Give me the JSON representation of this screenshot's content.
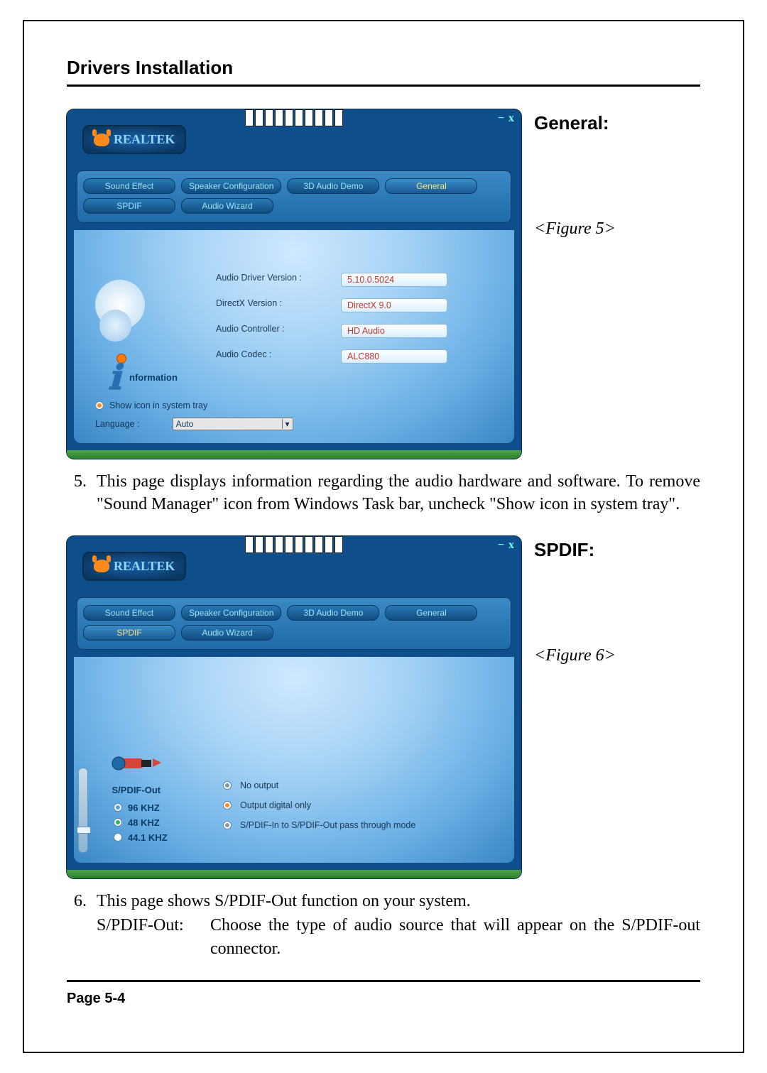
{
  "doc": {
    "section_title": "Drivers Installation",
    "page_label": "Page 5-4"
  },
  "fig5": {
    "side_title": "General:",
    "caption": "<Figure 5>",
    "brand": "REALTEK",
    "win_min": "−",
    "win_close": "x",
    "tabs_row1": [
      "Sound Effect",
      "Speaker Configuration",
      "3D Audio Demo",
      "General"
    ],
    "tabs_row2": [
      "SPDIF",
      "Audio Wizard"
    ],
    "active_tab": "General",
    "info_label": "nformation",
    "fields": {
      "driver_label": "Audio Driver Version :",
      "driver_value": "5.10.0.5024",
      "directx_label": "DirectX Version :",
      "directx_value": "DirectX 9.0",
      "controller_label": "Audio Controller :",
      "controller_value": "HD Audio",
      "codec_label": "Audio Codec :",
      "codec_value": "ALC880"
    },
    "tray_label": "Show icon in system tray",
    "lang_label": "Language :",
    "lang_value": "Auto"
  },
  "para5": {
    "num": "5.",
    "text": "This page displays information regarding the audio hardware and software. To remove \"Sound Manager\" icon from Windows Task bar, uncheck \"Show icon in system tray\"."
  },
  "fig6": {
    "side_title": "SPDIF:",
    "caption": "<Figure 6>",
    "brand": "REALTEK",
    "tabs_row1": [
      "Sound Effect",
      "Speaker Configuration",
      "3D Audio Demo",
      "General"
    ],
    "tabs_row2": [
      "SPDIF",
      "Audio Wizard"
    ],
    "active_tab": "SPDIF",
    "out_label": "S/PDIF-Out",
    "rates": [
      "96 KHZ",
      "48 KHZ",
      "44.1 KHZ"
    ],
    "options": {
      "no_output": "No output",
      "digital_only": "Output digital only",
      "passthrough": "S/PDIF-In to S/PDIF-Out pass through mode"
    }
  },
  "para6": {
    "num": "6.",
    "line1": "This page shows S/PDIF-Out function on your system.",
    "term": "S/PDIF-Out:",
    "def": "Choose the type of audio source that will appear on the S/PDIF-out connector."
  }
}
